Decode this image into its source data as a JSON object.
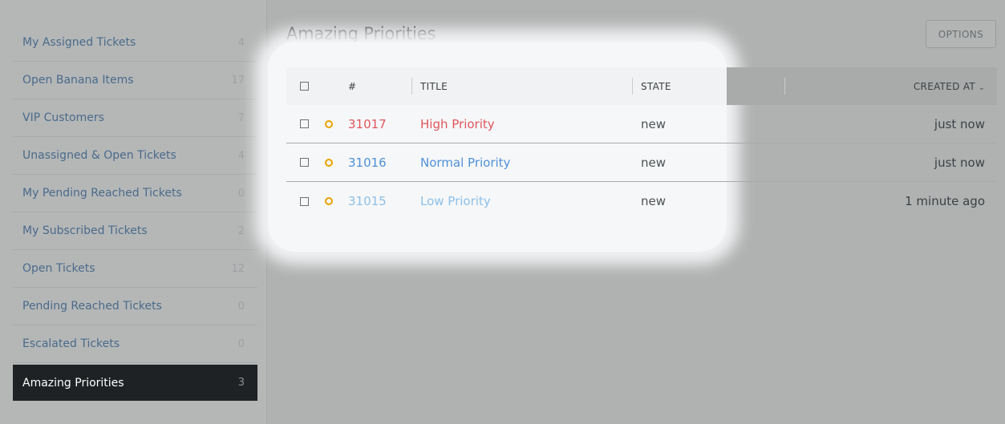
{
  "sidebar": {
    "items": [
      {
        "label": "My Assigned Tickets",
        "count": "4"
      },
      {
        "label": "Open Banana Items",
        "count": "17"
      },
      {
        "label": "VIP Customers",
        "count": "7"
      },
      {
        "label": "Unassigned & Open Tickets",
        "count": "4"
      },
      {
        "label": "My Pending Reached Tickets",
        "count": "0"
      },
      {
        "label": "My Subscribed Tickets",
        "count": "2"
      },
      {
        "label": "Open Tickets",
        "count": "12"
      },
      {
        "label": "Pending Reached Tickets",
        "count": "0"
      },
      {
        "label": "Escalated Tickets",
        "count": "0"
      },
      {
        "label": "Amazing Priorities",
        "count": "3",
        "active": true
      }
    ]
  },
  "header": {
    "title": "Amazing Priorities",
    "options_label": "OPTIONS"
  },
  "table": {
    "columns": {
      "number": "#",
      "title": "TITLE",
      "state": "STATE",
      "created": "CREATED AT",
      "sort_icon": "chevron-down-icon"
    },
    "rows": [
      {
        "number": "31017",
        "title": "High Priority",
        "state": "new",
        "created": "just now",
        "priority": "high"
      },
      {
        "number": "31016",
        "title": "Normal Priority",
        "state": "new",
        "created": "just now",
        "priority": "normal"
      },
      {
        "number": "31015",
        "title": "Low Priority",
        "state": "new",
        "created": "1 minute ago",
        "priority": "low"
      }
    ]
  },
  "colors": {
    "high": "#e0565d",
    "normal": "#4f90d8",
    "low": "#8cc0e8",
    "priority_icon": "#e8a200",
    "active_nav": "#1f2224"
  }
}
